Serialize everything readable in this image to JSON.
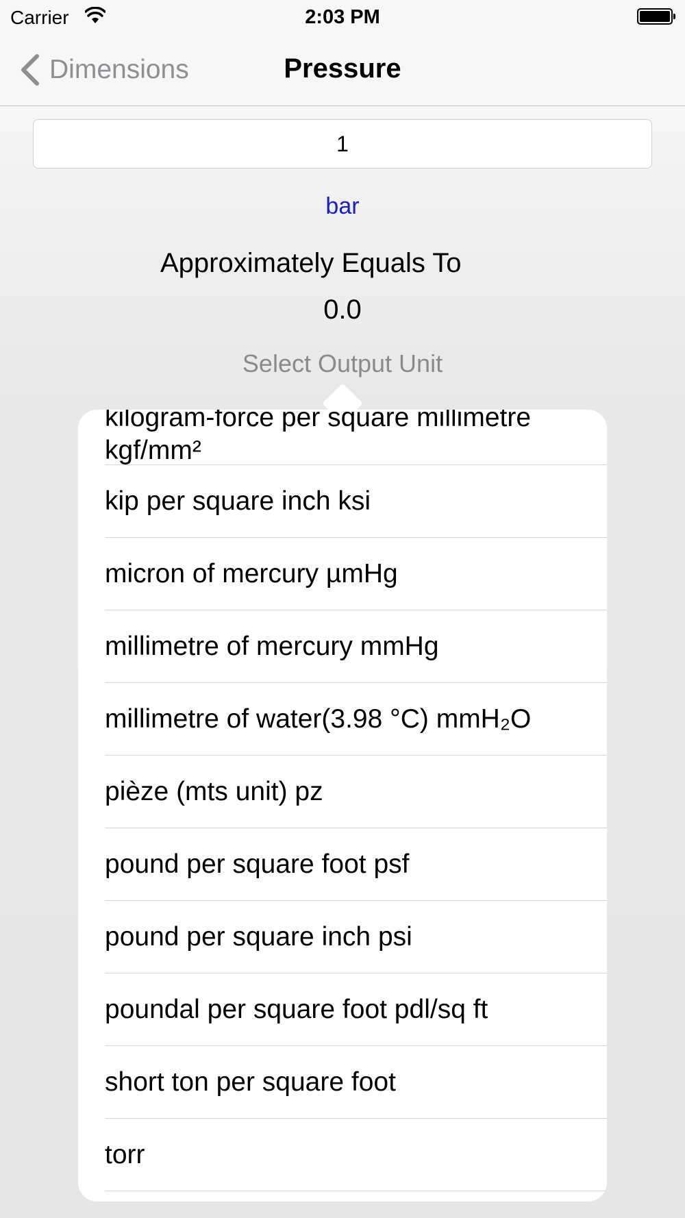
{
  "status_bar": {
    "carrier": "Carrier",
    "time": "2:03 PM"
  },
  "nav": {
    "back_label": "Dimensions",
    "title": "Pressure"
  },
  "converter": {
    "input_value": "1",
    "input_unit": "bar",
    "approx_label": "Approximately Equals To",
    "result": "0.0",
    "select_output_label": "Select Output Unit"
  },
  "output_units": [
    {
      "label": "kilogram-force per square millimetre",
      "label_line2": "kgf/mm²"
    },
    {
      "label": "kip per square inch ksi"
    },
    {
      "label": "micron of mercury µmHg"
    },
    {
      "label": "millimetre of mercury mmHg"
    },
    {
      "label": "millimetre of water(3.98 °C)  mmH₂O"
    },
    {
      "label": "pièze (mts unit) pz"
    },
    {
      "label": "pound per square foot psf"
    },
    {
      "label": "pound per square inch psi"
    },
    {
      "label": "poundal per square foot pdl/sq ft"
    },
    {
      "label": "short ton per square foot"
    },
    {
      "label": "torr"
    }
  ],
  "colors": {
    "link_blue": "#1a1ad6",
    "back_gray": "#8e8e93",
    "hint_gray": "#8a8a8a"
  },
  "icons": {
    "back": "chevron-left-icon",
    "wifi": "wifi-icon",
    "battery": "battery-icon"
  }
}
